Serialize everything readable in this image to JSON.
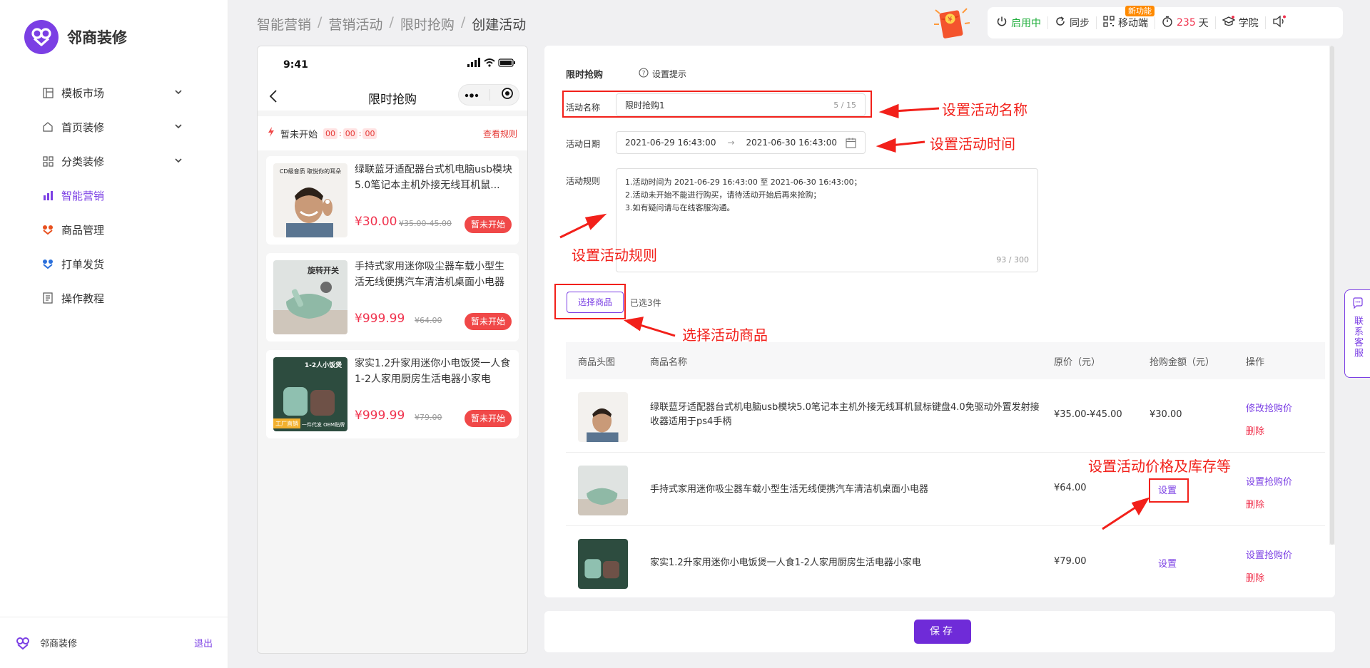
{
  "app": {
    "name": "邻商装修",
    "logout": "退出"
  },
  "sidebar": {
    "items": [
      {
        "label": "模板市场",
        "icon": "template-icon",
        "has_chevron": true
      },
      {
        "label": "首页装修",
        "icon": "home-icon",
        "has_chevron": true
      },
      {
        "label": "分类装修",
        "icon": "category-icon",
        "has_chevron": true
      },
      {
        "label": "智能营销",
        "icon": "marketing-icon",
        "active": true
      },
      {
        "label": "商品管理",
        "icon": "goods-icon"
      },
      {
        "label": "打单发货",
        "icon": "shipping-icon"
      },
      {
        "label": "操作教程",
        "icon": "tutorial-icon"
      }
    ]
  },
  "breadcrumb": [
    "智能营销",
    "营销活动",
    "限时抢购",
    "创建活动"
  ],
  "topbar": {
    "status": "启用中",
    "sync": "同步",
    "mobile": "移动端",
    "new_badge": "新功能",
    "days_value": "235",
    "days_unit": "天",
    "academy": "学院",
    "status_color": "#1fae3b",
    "days_color": "#f0334e"
  },
  "phone": {
    "time": "9:41",
    "title": "限时抢购",
    "countdown_label": "暂未开始",
    "countdown": [
      "00",
      "00",
      "00"
    ],
    "rules_link": "查看规则",
    "products": [
      {
        "name": "绿联蓝牙适配器台式机电脑usb模块5.0笔记本主机外接无线耳机鼠...",
        "price": "¥30.00",
        "original": "¥35.00-45.00",
        "button": "暂未开始",
        "img_text": "CD级音质 取悦你的耳朵"
      },
      {
        "name": "手持式家用迷你吸尘器车载小型生活无线便携汽车清洁机桌面小电器",
        "price": "¥999.99",
        "original": "¥64.00",
        "button": "暂未开始",
        "img_text": "旋转开关"
      },
      {
        "name": "家实1.2升家用迷你小电饭煲一人食1-2人家用厨房生活电器小家电",
        "price": "¥999.99",
        "original": "¥79.00",
        "button": "暂未开始",
        "img_text": "1-2人小饭煲",
        "img_badge": "工厂直销",
        "img_sub": "一件代发 OEM贴牌"
      }
    ]
  },
  "form": {
    "section_title": "限时抢购",
    "tip": "设置提示",
    "name_label": "活动名称",
    "name_value": "限时抢购1",
    "name_count": "5 / 15",
    "date_label": "活动日期",
    "date_start": "2021-06-29 16:43:00",
    "date_arrow": "→",
    "date_end": "2021-06-30 16:43:00",
    "rules_label": "活动规则",
    "rules_lines": [
      "1.活动时间为 2021-06-29 16:43:00 至 2021-06-30 16:43:00；",
      "2.活动未开始不能进行购买，请待活动开始后再来抢购；",
      "3.如有疑问请与在线客服沟通。"
    ],
    "rules_count": "93 / 300",
    "select_button": "选择商品",
    "selected_count": "已选3件"
  },
  "table": {
    "headers": [
      "商品头图",
      "商品名称",
      "原价（元）",
      "抢购金额（元）",
      "操作"
    ],
    "rows": [
      {
        "name": "绿联蓝牙适配器台式机电脑usb模块5.0笔记本主机外接无线耳机鼠标键盘4.0免驱动外置发射接收器适用于ps4手柄",
        "original": "¥35.00-¥45.00",
        "flash": "¥30.00",
        "action1": "修改抢购价",
        "action2": "删除"
      },
      {
        "name": "手持式家用迷你吸尘器车载小型生活无线便携汽车清洁机桌面小电器",
        "original": "¥64.00",
        "flash_link": "设置",
        "action1": "设置抢购价",
        "action2": "删除"
      },
      {
        "name": "家实1.2升家用迷你小电饭煲一人食1-2人家用厨房生活电器小家电",
        "original": "¥79.00",
        "flash_link": "设置",
        "action1": "设置抢购价",
        "action2": "删除"
      }
    ]
  },
  "save_button": "保存",
  "customer_service": "联系客服",
  "annotations": {
    "name": "设置活动名称",
    "time": "设置活动时间",
    "rules": "设置活动规则",
    "goods": "选择活动商品",
    "price": "设置活动价格及库存等"
  },
  "colors": {
    "brand": "#7b3fe4",
    "accent_red": "#f2201a",
    "price_red": "#f0334e"
  }
}
